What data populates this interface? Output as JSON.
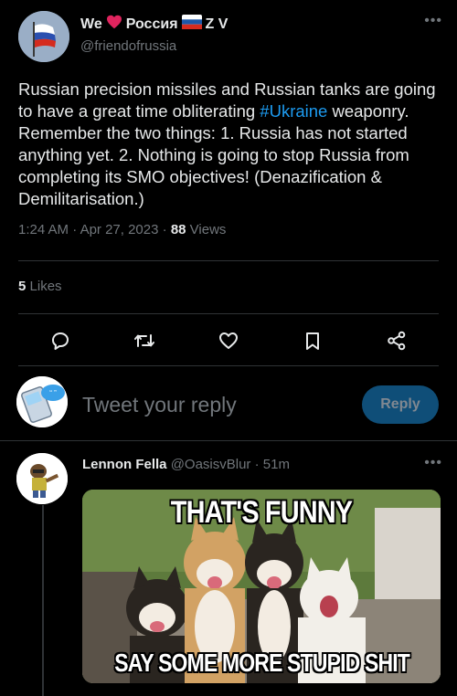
{
  "author": {
    "display_name_prefix": "We",
    "display_name_mid": "Россия",
    "display_name_suffix": "Z V",
    "handle": "@friendofrussia"
  },
  "tweet": {
    "text_before": "Russian precision missiles and Russian tanks are going to have a great time obliterating ",
    "hashtag": "#Ukraine",
    "text_after": " weaponry. Remember the two things: 1. Russia has not started anything yet. 2. Nothing is going to stop Russia from completing its SMO objectives! (Denazification & Demilitarisation.)",
    "time": "1:24 AM",
    "date": "Apr 27, 2023",
    "views_count": "88",
    "views_label": "Views",
    "likes_count": "5",
    "likes_label": "Likes"
  },
  "reply_box": {
    "placeholder": "Tweet your reply",
    "button_label": "Reply"
  },
  "reply": {
    "display_name": "Lennon Fella",
    "handle": "@OasisvBlur",
    "time": "51m",
    "meme_top_text": "THAT'S FUNNY",
    "meme_bottom_text": "SAY SOME MORE STUPID SHIT"
  },
  "icons": {
    "more": "more-dots-icon",
    "reply": "reply-bubble-icon",
    "retweet": "retweet-icon",
    "like": "heart-icon",
    "bookmark": "bookmark-icon",
    "share": "share-icon"
  },
  "colors": {
    "accent": "#1d9bf0",
    "reply_button_bg": "#0f4e78",
    "muted_text": "#71767b",
    "heart": "#f91880"
  }
}
